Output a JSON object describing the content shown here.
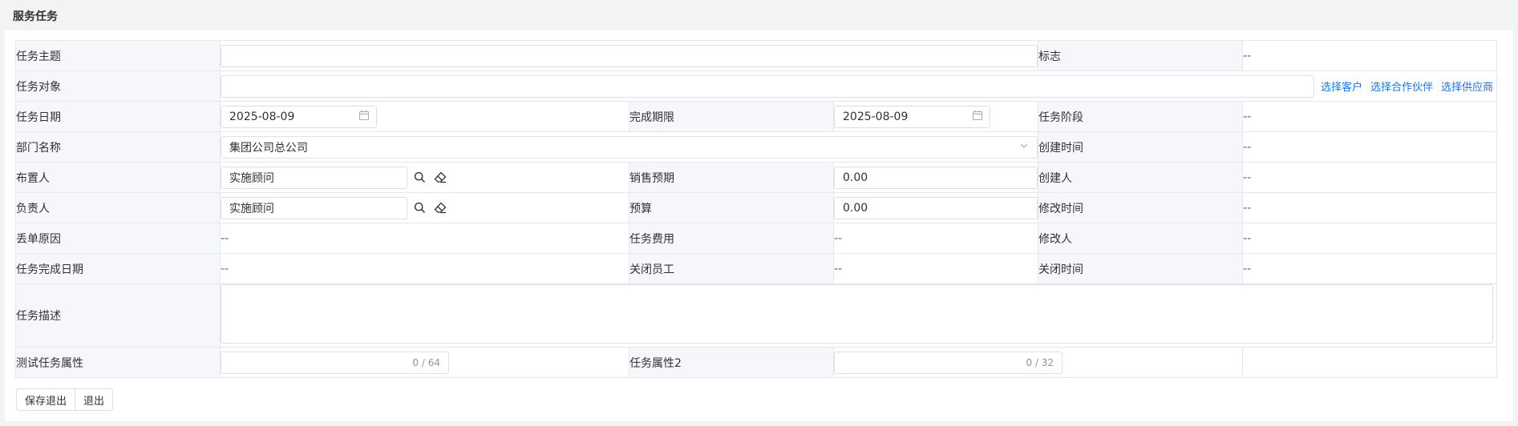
{
  "page": {
    "title": "服务任务"
  },
  "form": {
    "subject": {
      "label": "任务主题",
      "value": ""
    },
    "flag": {
      "label": "标志",
      "value": "--"
    },
    "target": {
      "label": "任务对象",
      "value": "",
      "links": [
        "选择客户",
        "选择合作伙伴",
        "选择供应商"
      ]
    },
    "task_date": {
      "label": "任务日期",
      "value": "2025-08-09"
    },
    "deadline": {
      "label": "完成期限",
      "value": "2025-08-09"
    },
    "stage": {
      "label": "任务阶段",
      "value": "--"
    },
    "department": {
      "label": "部门名称",
      "value": "集团公司总公司"
    },
    "created_time": {
      "label": "创建时间",
      "value": "--"
    },
    "assigner": {
      "label": "布置人",
      "value": "实施顾问"
    },
    "sales_forecast": {
      "label": "销售预期",
      "value": "0.00"
    },
    "creator": {
      "label": "创建人",
      "value": "--"
    },
    "owner": {
      "label": "负责人",
      "value": "实施顾问"
    },
    "budget": {
      "label": "预算",
      "value": "0.00"
    },
    "modified_time": {
      "label": "修改时间",
      "value": "--"
    },
    "reject_reason": {
      "label": "丢单原因",
      "value": "--"
    },
    "cost": {
      "label": "任务费用",
      "value": "--"
    },
    "modifier": {
      "label": "修改人",
      "value": "--"
    },
    "complete_date": {
      "label": "任务完成日期",
      "value": "--"
    },
    "closed_by": {
      "label": "关闭员工",
      "value": "--"
    },
    "closed_time": {
      "label": "关闭时间",
      "value": "--"
    },
    "description": {
      "label": "任务描述",
      "value": ""
    },
    "test_attr": {
      "label": "测试任务属性",
      "counter": "0 / 64"
    },
    "attr2": {
      "label": "任务属性2",
      "counter": "0 / 32"
    }
  },
  "actions": {
    "save_exit": "保存退出",
    "exit": "退出"
  },
  "icons": {
    "calendar": "calendar-icon",
    "search": "search-icon",
    "clear": "eraser-icon",
    "dropdown": "chevron-down-icon"
  },
  "colors": {
    "link": "#1677e5",
    "label_bg": "#f5f7fa",
    "border": "#e4e7ed",
    "page_bg": "#f2f3f5"
  }
}
